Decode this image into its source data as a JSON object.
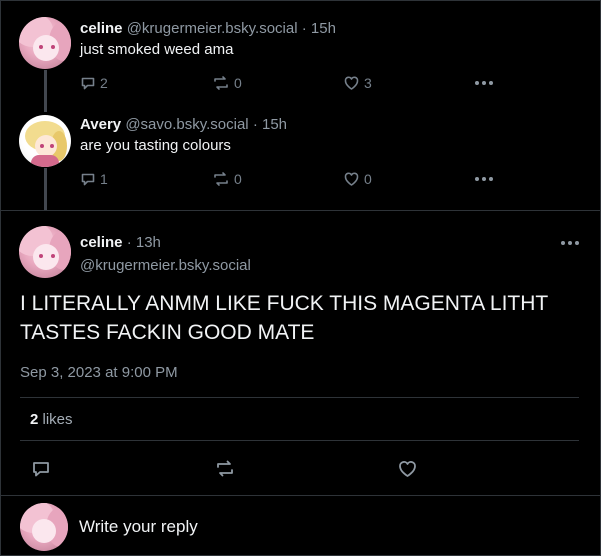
{
  "posts": [
    {
      "name": "celine",
      "handle": "@krugermeier.bsky.social",
      "time": "15h",
      "text": "just smoked weed ama",
      "replies": "2",
      "reposts": "0",
      "likes": "3"
    },
    {
      "name": "Avery",
      "handle": "@savo.bsky.social",
      "time": "15h",
      "text": "are you tasting colours",
      "replies": "1",
      "reposts": "0",
      "likes": "0"
    }
  ],
  "main": {
    "name": "celine",
    "time": "13h",
    "handle": "@krugermeier.bsky.social",
    "text": "I LITERALLY ANMM LIKE FUCK THIS MAGENTA LITHT TASTES FACKIN GOOD MATE",
    "date": "Sep 3, 2023 at 9:00 PM",
    "likes_count": "2",
    "likes_label": "likes"
  },
  "reply": {
    "placeholder": "Write your reply"
  },
  "separator": "·",
  "colors": {
    "background": "#000000",
    "text": "#f1f3f5",
    "muted": "#8f99a3",
    "divider": "#2e3338"
  }
}
